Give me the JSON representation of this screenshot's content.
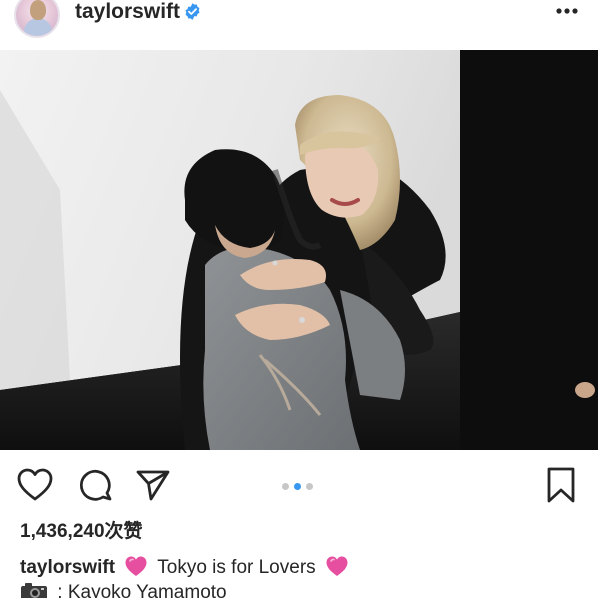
{
  "post": {
    "username": "taylorswift",
    "verified": true,
    "more_icon": "more-horizontal-icon",
    "photo_icon": "photo",
    "likes": "1,436,240次赞",
    "caption": {
      "username": "taylorswift",
      "text": "Tokyo is for Lovers",
      "emoji": "pink-heart-emoji"
    },
    "credit": {
      "icon": "camera-emoji",
      "text": ": Kayoko Yamamoto"
    },
    "carousel": {
      "count": 3,
      "active": 2
    },
    "colors": {
      "accent_dot": "#3897f0",
      "verified": "#3897f0",
      "text": "#262626",
      "emoji_heart": "#e64fa0"
    }
  },
  "actions": {
    "like_icon": "heart-icon",
    "comment_icon": "comment-icon",
    "share_icon": "send-icon",
    "save_icon": "bookmark-icon"
  }
}
